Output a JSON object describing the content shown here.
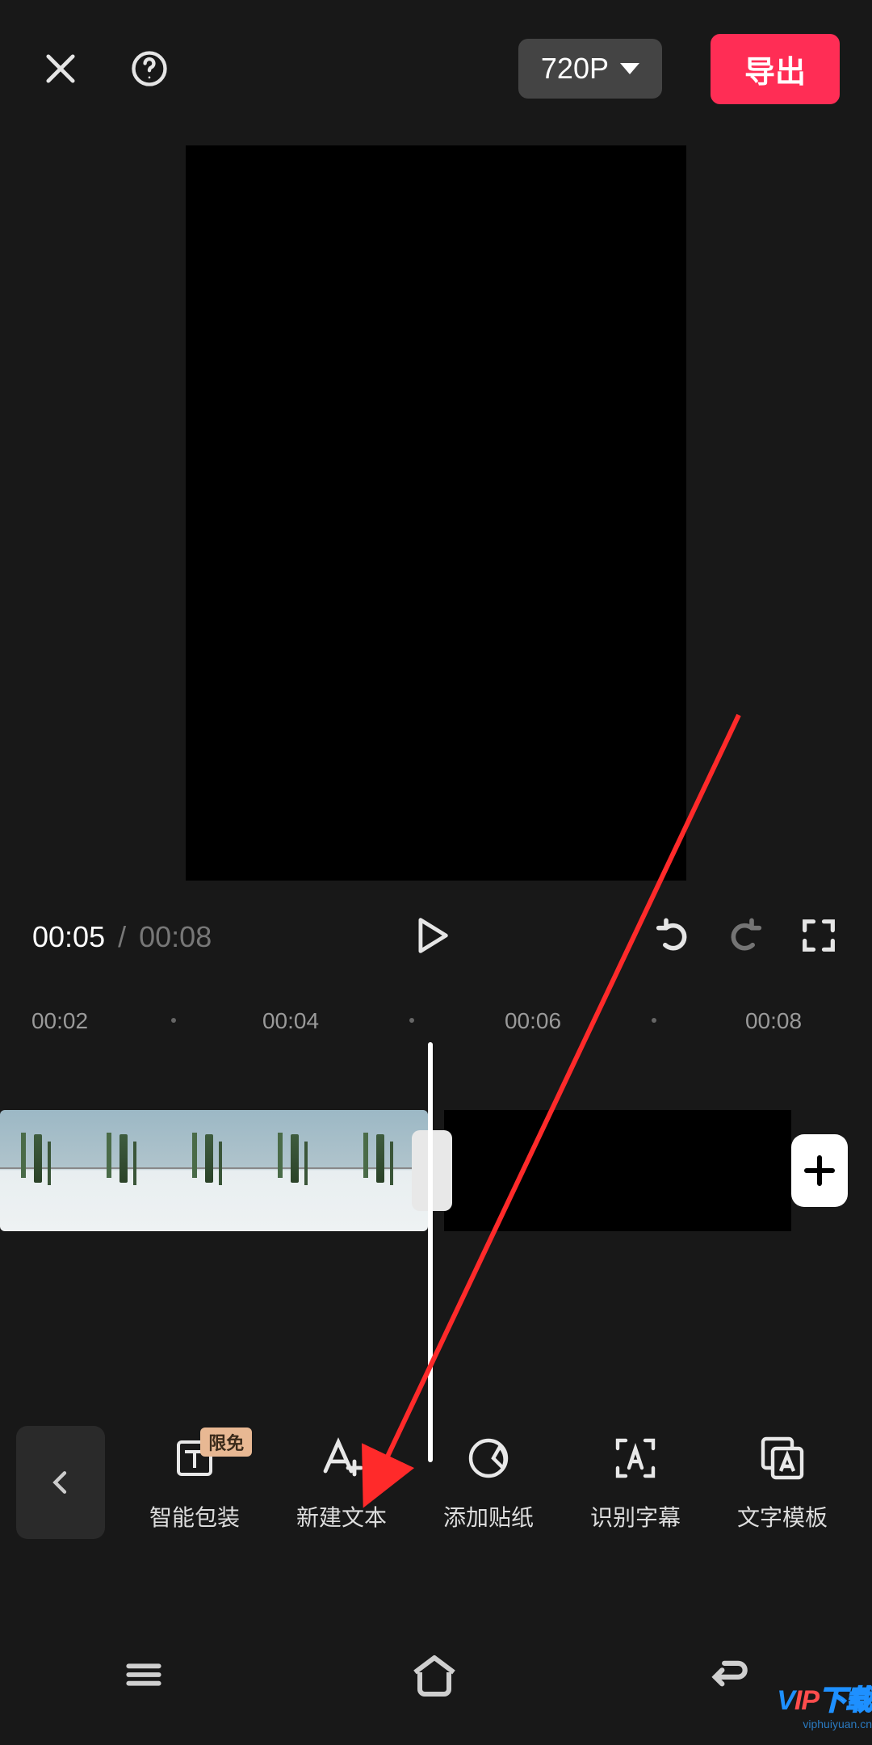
{
  "topbar": {
    "resolution_label": "720P",
    "export_label": "导出"
  },
  "playback": {
    "current_time": "00:05",
    "separator": "/",
    "duration": "00:08"
  },
  "ruler": {
    "ticks": [
      "00:02",
      "00:04",
      "00:06",
      "00:08"
    ]
  },
  "toolbar": {
    "items": [
      {
        "label": "智能包装",
        "badge": "限免"
      },
      {
        "label": "新建文本"
      },
      {
        "label": "添加贴纸"
      },
      {
        "label": "识别字幕"
      },
      {
        "label": "文字模板"
      }
    ]
  },
  "watermark": {
    "line1_prefix": "V",
    "line1_mid": "IP",
    "line1_suffix": "下载",
    "line2": "viphuiyuan.cn"
  },
  "colors": {
    "accent": "#ff2d55",
    "badge_bg": "#e8b893"
  }
}
